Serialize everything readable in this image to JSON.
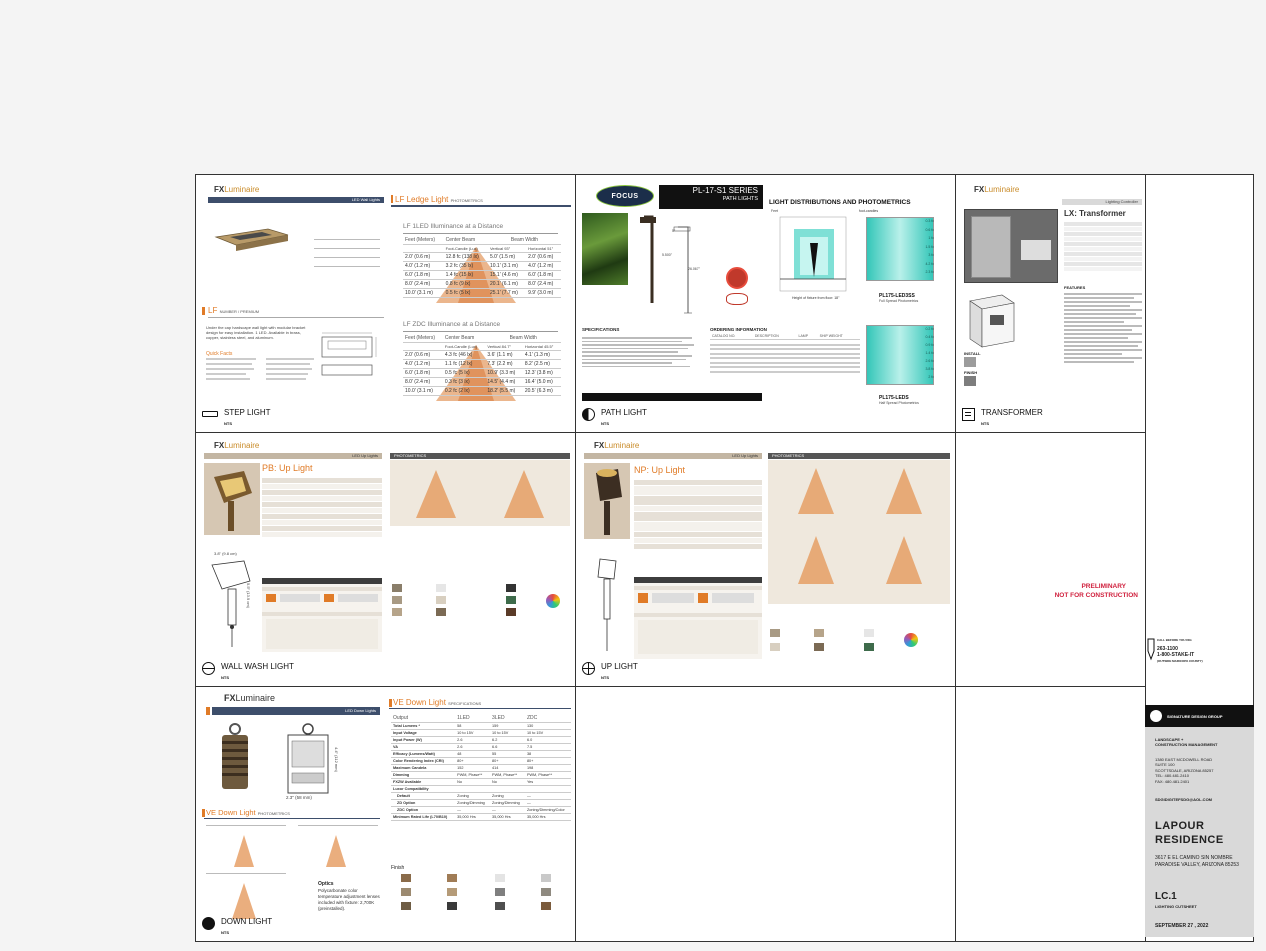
{
  "sheet": {
    "step": {
      "caption": "STEP LIGHT",
      "nts": "NTS",
      "brand_fx": "FX",
      "brand_rest": "Luminaire",
      "category": "LED Wall Lights",
      "family": "LF",
      "family_sub": "Ledge Light",
      "photometrics_label": "PHOTOMETRICS",
      "series_label": "LF",
      "series_sub": "NUMBER / PREMIUM",
      "description": "Under the cap hardscape wall light with modular bracket design for easy installation. 1 LED. Available in brass, copper, stainless steel, and aluminum.",
      "quick_facts_label": "Quick Facts",
      "table1_title": "LF 1LED Illuminance at a Distance",
      "table2_title": "LF ZDC Illuminance at a Distance",
      "col_feet": "Feet (Meters)",
      "col_center": "Center Beam",
      "col_beam": "Beam Width",
      "col_fc": "Foot-Candle (Lux)",
      "col_vert1": "Vertical 93°",
      "col_horiz1": "Horizontal 51°",
      "col_vert2": "Vertical 84.7°",
      "col_horiz2": "Horizontal 45.5°",
      "t1_rows": [
        [
          "2.0' (0.6 m)",
          "12.8 fc (138 lx)",
          "5.0' (1.5 m)",
          "2.0' (0.6 m)"
        ],
        [
          "4.0' (1.2 m)",
          "3.2 fc (35 lx)",
          "10.1' (3.1 m)",
          "4.0' (1.2 m)"
        ],
        [
          "6.0' (1.8 m)",
          "1.4 fc (15 lx)",
          "15.1' (4.6 m)",
          "6.0' (1.8 m)"
        ],
        [
          "8.0' (2.4 m)",
          "0.8 fc (9 lx)",
          "20.1' (6.1 m)",
          "8.0' (2.4 m)"
        ],
        [
          "10.0' (3.1 m)",
          "0.5 fc (5 lx)",
          "25.1' (7.7 m)",
          "9.9' (3.0 m)"
        ]
      ],
      "t2_rows": [
        [
          "2.0' (0.6 m)",
          "4.3 fc (46 lx)",
          "3.6' (1.1 m)",
          "4.1' (1.3 m)"
        ],
        [
          "4.0' (1.2 m)",
          "1.1 fc (12 lx)",
          "7.3' (2.2 m)",
          "8.2' (2.5 m)"
        ],
        [
          "6.0' (1.8 m)",
          "0.5 fc (5 lx)",
          "10.9' (3.3 m)",
          "12.3' (3.8 m)"
        ],
        [
          "8.0' (2.4 m)",
          "0.3 fc (3 lx)",
          "14.5' (4.4 m)",
          "16.4' (5.0 m)"
        ],
        [
          "10.0' (3.1 m)",
          "0.2 fc (2 lx)",
          "18.2' (5.5 m)",
          "20.5' (6.3 m)"
        ]
      ]
    },
    "path": {
      "caption": "PATH LIGHT",
      "nts": "NTS",
      "logo": "FOCUS",
      "model": "PL-17-S1 SERIES",
      "subtitle": "PATH LIGHTS",
      "dist_title": "LIGHT DISTRIBUTIONS AND PHOTOMETRICS",
      "spec_title": "SPECIFICATIONS",
      "order_title": "ORDERING INFORMATION",
      "order_cols": [
        "CATALOG NO.",
        "DESCRIPTION",
        "LAMP",
        "SHIP WEIGHT"
      ],
      "chart1_label": "PL175-LED3SS",
      "chart1_sub": "Full Spread Photometrics",
      "chart2_label": "PL175-LEDS",
      "chart2_sub": "Half Spread Photometrics",
      "axis_feet": "Feet",
      "axis_meters": "Meters",
      "fc_label": "foot-candles",
      "height_label": "Height of fixture from floor: 18\"",
      "dim_height": "26.067\"",
      "dim_width": "5\"",
      "dim_dia": "5.500\"",
      "chart1_values": [
        0.3,
        0.6,
        1.0,
        1.5,
        3.0,
        4.2,
        2.3
      ],
      "chart2_values": [
        0.2,
        0.4,
        0.9,
        1.4,
        2.6,
        3.8,
        2.0
      ]
    },
    "transformer": {
      "caption": "TRANSFORMER",
      "nts": "NTS",
      "brand_fx": "FX",
      "brand_rest": "Luminaire",
      "category": "Lighting Controller",
      "title": "LX: Transformer",
      "features_label": "FEATURES",
      "finish_label": "FINISH",
      "install_label": "INSTALL"
    },
    "wallwash": {
      "caption": "WALL WASH LIGHT",
      "nts": "NTS",
      "brand_fx": "FX",
      "brand_rest": "Luminaire",
      "category": "LED Up Lights",
      "title_main": "PB:",
      "title_sub": "Up Light",
      "photometrics_label": "PHOTOMETRICS",
      "dim_width": "3.8\" (9.8 cm)",
      "dim_height": "5.5\" (13.9 cm)"
    },
    "uplight": {
      "caption": "UP LIGHT",
      "nts": "NTS",
      "brand_fx": "FX",
      "brand_rest": "Luminaire",
      "category": "LED Up Lights",
      "title_main": "NP:",
      "title_sub": "Up Light",
      "photometrics_label": "PHOTOMETRICS"
    },
    "downlight": {
      "caption": "DOWN LIGHT",
      "nts": "NTS",
      "brand_fx": "FX",
      "brand_rest": "Luminaire",
      "category": "LED Down Lights",
      "family": "VE",
      "family_sub": "Down Light",
      "spec_label": "SPECIFICATIONS",
      "photometrics_label": "PHOTOMETRICS",
      "dim_width": "2.3\" (58 mm)",
      "dim_height": "4.4\" (112 mm)",
      "spec_cols": [
        "Output",
        "1LED",
        "3LED",
        "ZDC"
      ],
      "spec_rows": [
        [
          "Total Lumens *",
          "58",
          "159",
          "130"
        ],
        [
          "Input Voltage",
          "10 to 15V",
          "10 to 15V",
          "10 to 15V"
        ],
        [
          "Input Power (W)",
          "2.6",
          "6.2",
          "6.0"
        ],
        [
          "VA",
          "2.6",
          "6.6",
          "7.5"
        ],
        [
          "Efficacy (Lumens/Watt)",
          "48",
          "55",
          "38"
        ],
        [
          "Color Rendering Index (CRI)",
          "80+",
          "80+",
          "80+"
        ],
        [
          "Maximum Candela",
          "152",
          "414",
          "198"
        ],
        [
          "Dimming",
          "PWM, Phase**",
          "PWM, Phase**",
          "PWM, Phase**"
        ],
        [
          "FXZW Available",
          "No",
          "No",
          "Yes"
        ],
        [
          "Luxor Compatibility",
          "",
          "",
          ""
        ],
        [
          "Default",
          "Zoning",
          "Zoning",
          "—"
        ],
        [
          "ZD Option",
          "Zoning/Dimming",
          "Zoning/Dimming",
          "—"
        ],
        [
          "ZDC Option",
          "—",
          "—",
          "Zoning/Dimming/Color"
        ],
        [
          "Minimum Rated Life (L70/B10)",
          "35,000 Hrs",
          "35,000 Hrs",
          "35,000 Hrs"
        ]
      ],
      "options_label": "Optics",
      "options_text": "Polycarbonate color temperature adjustment lenses included with fixture: 2,700K (preinstalled).",
      "finish_label": "Finish"
    },
    "notice": {
      "line1": "PRELIMINARY",
      "line2": "NOT FOR CONSTRUCTION"
    },
    "dig": {
      "top": "CALL BEFORE YOU DIG",
      "num1": "263-1100",
      "num2": "1-800-STAKE-IT",
      "bottom": "(OUTSIDE MARICOPA COUNTY)"
    },
    "title_block": {
      "firm": "SIGNATURE DESIGN GROUP",
      "role1": "LANDSCAPE +",
      "role2": "CONSTRUCTION MANAGEMENT",
      "addr1": "1380 EAST MCDOWELL ROAD",
      "addr2": "SUITE 100",
      "addr3": "SCOTTSDALE, ARIZONA 85257",
      "tel": "TEL: 480.481.2410",
      "fax": "FAX: 480.481.2401",
      "email": "SDGIDIGITEFSDG@AOL.COM",
      "project1": "LAPOUR",
      "project2": "RESIDENCE",
      "proj_addr1": "3617 E EL CAMINO SIN NOMBRE",
      "proj_addr2": "PARADISE VALLEY, ARIZONA 85253",
      "sheet_no": "LC.1",
      "sheet_name": "LIGHTING CUTSHEET",
      "date": "SEPTEMBER 27 , 2022"
    }
  }
}
